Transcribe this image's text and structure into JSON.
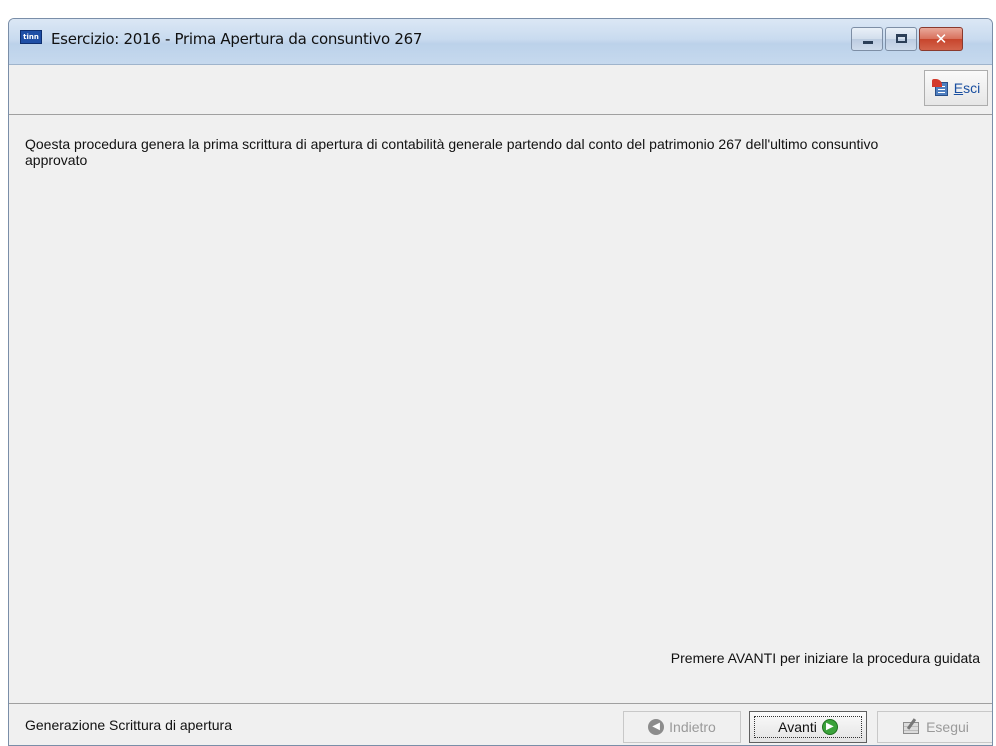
{
  "window": {
    "title": "Esercizio: 2016 - Prima Apertura da consuntivo 267",
    "app_icon_text": "tinn",
    "controls": {
      "minimize_icon": "minimize-icon",
      "maximize_icon": "maximize-icon",
      "close_icon": "close-icon",
      "close_glyph": "✕"
    }
  },
  "toolbar": {
    "exit_label_first": "E",
    "exit_label_rest": "sci",
    "exit_icon": "exit-icon"
  },
  "content": {
    "description": "Qoesta procedura genera la prima scrittura di apertura di contabilità generale partendo dal conto del patrimonio 267 dell'ultimo consuntivo approvato",
    "hint": "Premere AVANTI per iniziare la procedura guidata"
  },
  "statusbar": {
    "title": "Generazione Scrittura di apertura",
    "back_label": "Indietro",
    "next_label": "Avanti",
    "execute_label": "Esegui",
    "back_glyph": "◀",
    "next_glyph": "▶"
  },
  "colors": {
    "title_gradient_top": "#dbe7f5",
    "close_red": "#c7452c",
    "window_bg": "#f0f0f0",
    "link_blue": "#1a4fa0",
    "next_green": "#3aa23a",
    "disabled_text": "#9a9a9a"
  }
}
